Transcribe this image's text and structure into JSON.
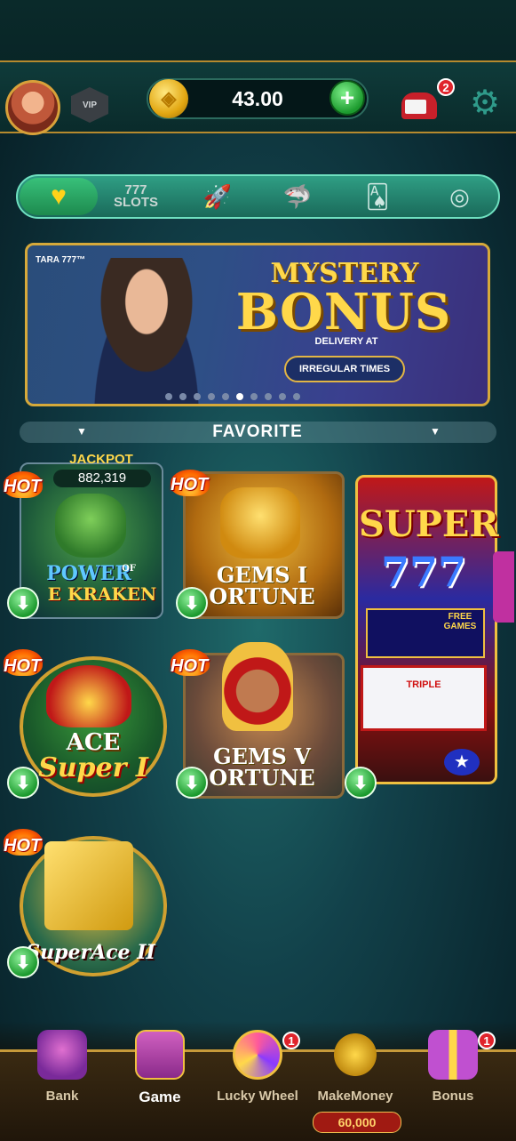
{
  "header": {
    "balance": "43.00",
    "vip_label": "VIP",
    "mail_badge": "2"
  },
  "categories": [
    {
      "name": "favorite",
      "label": ""
    },
    {
      "name": "slots",
      "label": "777 SLOTS"
    },
    {
      "name": "rocket",
      "label": ""
    },
    {
      "name": "shark",
      "label": ""
    },
    {
      "name": "cards",
      "label": ""
    },
    {
      "name": "roulette",
      "label": ""
    }
  ],
  "banner": {
    "brand": "TARA 777™",
    "title_line1": "MYSTERY",
    "title_line2": "BONUS",
    "subtitle": "DELIVERY AT",
    "button": "IRREGULAR TIMES",
    "dots_total": 10,
    "dots_active": 6
  },
  "section": {
    "title": "FAVORITE"
  },
  "games": {
    "kraken": {
      "jackpot_label": "JACKPOT",
      "jackpot_value": "882,319",
      "title_top": "POWER",
      "title_of": "OF",
      "title_bottom": "E KRAKEN",
      "hot": "HOT"
    },
    "gems1": {
      "title_top": "GEMS I",
      "title_bottom": "ORTUNE",
      "hot": "HOT"
    },
    "super777": {
      "title": "SUPER",
      "digits": "777",
      "free_games": "FREE GAMES",
      "triple": "TRIPLE"
    },
    "ace": {
      "title_top": "ACE",
      "title_bottom": "Super I",
      "hot": "HOT"
    },
    "gems5": {
      "title_top": "GEMS V",
      "title_bottom": "ORTUNE",
      "hot": "HOT"
    },
    "superace2": {
      "title": "SuperAce II",
      "hot": "HOT"
    }
  },
  "nav": {
    "bank": "Bank",
    "game": "Game",
    "lucky_wheel": "Lucky Wheel",
    "lucky_badge": "1",
    "make_money": "MakeMoney",
    "bonus": "Bonus",
    "bonus_badge": "1",
    "prize": "60,000"
  }
}
